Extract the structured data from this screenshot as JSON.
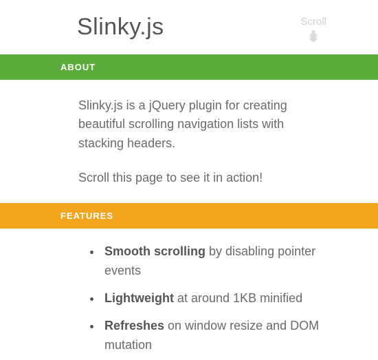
{
  "header": {
    "title": "Slinky.js",
    "scroll_label": "Scroll"
  },
  "about": {
    "heading": "ABOUT",
    "p1": "Slinky.js is a jQuery plugin for creating beautiful scrolling navigation lists with stacking headers.",
    "p2": "Scroll this page to see it in action!"
  },
  "features": {
    "heading": "FEATURES",
    "items": [
      {
        "strong": "Smooth scrolling",
        "rest": " by disabling pointer events"
      },
      {
        "strong": "Lightweight",
        "rest": " at around 1KB minified"
      },
      {
        "strong": "Refreshes",
        "rest": " on window resize and DOM mutation"
      }
    ]
  },
  "colors": {
    "about_bg": "#5aad3a",
    "features_bg": "#f4a51e"
  }
}
